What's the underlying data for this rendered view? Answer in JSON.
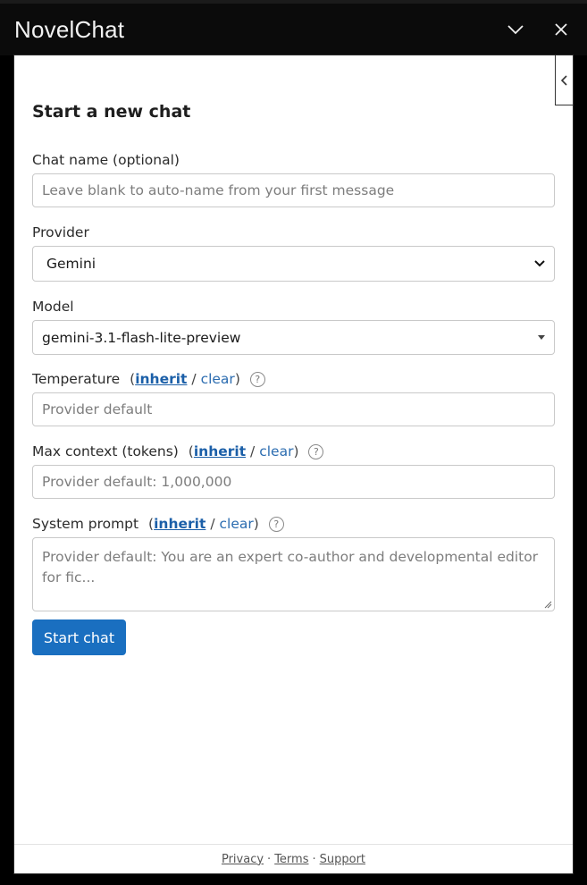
{
  "app": {
    "title": "NovelChat"
  },
  "form": {
    "heading": "Start a new chat",
    "chat_name": {
      "label": "Chat name (optional)",
      "placeholder": "Leave blank to auto-name from your first message"
    },
    "provider": {
      "label": "Provider",
      "value": "Gemini"
    },
    "model": {
      "label": "Model",
      "value": "gemini-3.1-flash-lite-preview"
    },
    "temperature": {
      "label": "Temperature",
      "inherit": "inherit",
      "clear": "clear",
      "placeholder": "Provider default"
    },
    "max_context": {
      "label": "Max context (tokens)",
      "inherit": "inherit",
      "clear": "clear",
      "placeholder": "Provider default: 1,000,000"
    },
    "system_prompt": {
      "label": "System prompt",
      "inherit": "inherit",
      "clear": "clear",
      "placeholder": "Provider default: You are an expert co-author and developmental editor for fic..."
    },
    "help_glyph": "?",
    "submit": "Start chat"
  },
  "footer": {
    "privacy": "Privacy",
    "terms": "Terms",
    "support": "Support",
    "separator": "·"
  },
  "icons": {
    "window": [
      "chevron-down-icon",
      "close-icon"
    ],
    "panel": "chevron-left-icon"
  }
}
